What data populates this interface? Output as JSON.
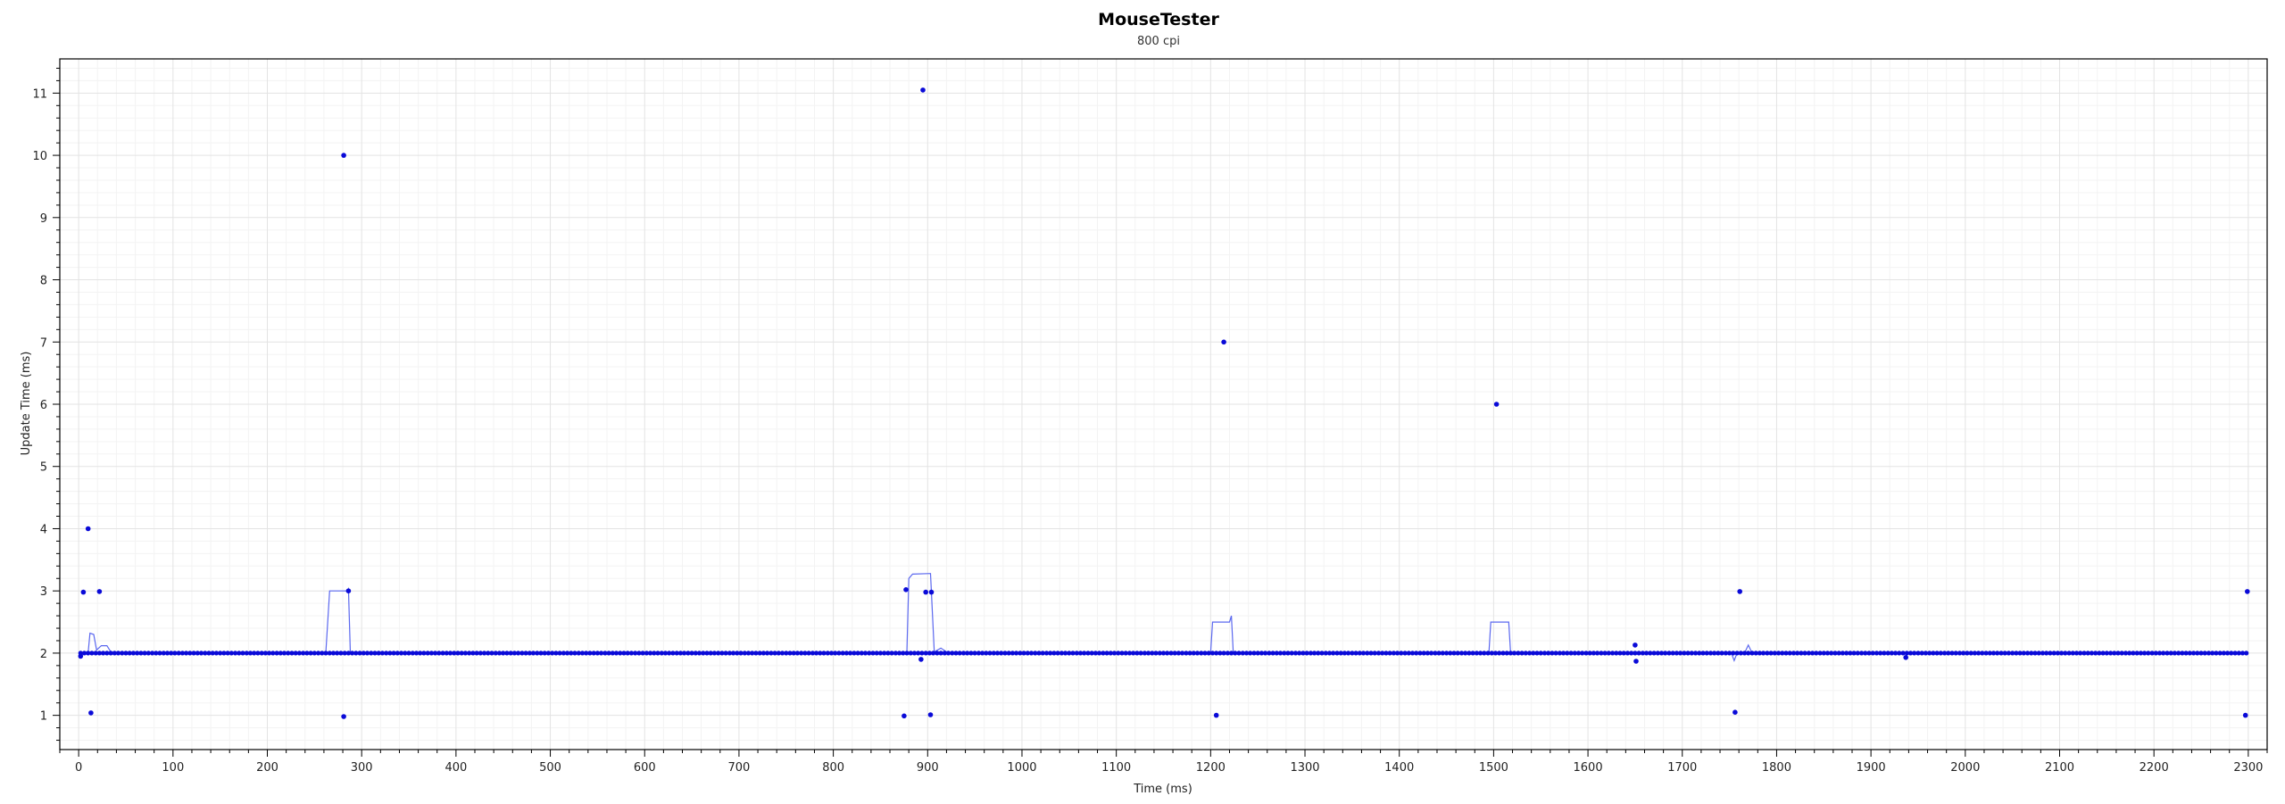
{
  "chart_data": {
    "type": "scatter",
    "title": "MouseTester",
    "subtitle": "800 cpi",
    "xlabel": "Time (ms)",
    "ylabel": "Update Time (ms)",
    "xlim": [
      -20,
      2320
    ],
    "ylim": [
      0.45,
      11.55
    ],
    "x_ticks": [
      0,
      100,
      200,
      300,
      400,
      500,
      600,
      700,
      800,
      900,
      1000,
      1100,
      1200,
      1300,
      1400,
      1500,
      1600,
      1700,
      1800,
      1900,
      2000,
      2100,
      2200,
      2300
    ],
    "y_ticks": [
      1,
      2,
      3,
      4,
      5,
      6,
      7,
      8,
      9,
      10,
      11
    ],
    "grid": true,
    "marker_color": "#0a0ad8",
    "line_color": "#5b68ef",
    "series": [
      {
        "kind": "points",
        "baseline": {
          "x_start": 2,
          "x_end": 2300,
          "step": 4,
          "y": 2
        },
        "outliers": [
          {
            "x": 2,
            "y": 1.95
          },
          {
            "x": 5,
            "y": 2.98
          },
          {
            "x": 10,
            "y": 4.0
          },
          {
            "x": 13,
            "y": 1.04
          },
          {
            "x": 22,
            "y": 2.99
          },
          {
            "x": 281,
            "y": 10.0
          },
          {
            "x": 281,
            "y": 0.98
          },
          {
            "x": 286,
            "y": 3.0
          },
          {
            "x": 875,
            "y": 0.99
          },
          {
            "x": 877,
            "y": 3.02
          },
          {
            "x": 893,
            "y": 1.9
          },
          {
            "x": 895,
            "y": 11.05
          },
          {
            "x": 898,
            "y": 2.98
          },
          {
            "x": 903,
            "y": 1.01
          },
          {
            "x": 904,
            "y": 2.98
          },
          {
            "x": 1206,
            "y": 1.0
          },
          {
            "x": 1214,
            "y": 7.0
          },
          {
            "x": 1503,
            "y": 6.0
          },
          {
            "x": 1650,
            "y": 2.13
          },
          {
            "x": 1651,
            "y": 1.87
          },
          {
            "x": 1756,
            "y": 1.05
          },
          {
            "x": 1761,
            "y": 2.99
          },
          {
            "x": 1937,
            "y": 1.93
          },
          {
            "x": 2297,
            "y": 1.0
          },
          {
            "x": 2299,
            "y": 2.99
          }
        ]
      },
      {
        "kind": "line",
        "points": [
          [
            2,
            2.0
          ],
          [
            10,
            2.0
          ],
          [
            12,
            2.32
          ],
          [
            16,
            2.3
          ],
          [
            19,
            2.05
          ],
          [
            24,
            2.12
          ],
          [
            30,
            2.12
          ],
          [
            34,
            2.02
          ],
          [
            40,
            2.0
          ],
          [
            262,
            2.0
          ],
          [
            266,
            3.0
          ],
          [
            285,
            3.0
          ],
          [
            286,
            3.03
          ],
          [
            288,
            2.0
          ],
          [
            878,
            2.0
          ],
          [
            880,
            3.2
          ],
          [
            884,
            3.27
          ],
          [
            903,
            3.28
          ],
          [
            907,
            2.02
          ],
          [
            914,
            2.08
          ],
          [
            922,
            2.0
          ],
          [
            1200,
            2.0
          ],
          [
            1202,
            2.5
          ],
          [
            1220,
            2.5
          ],
          [
            1222,
            2.6
          ],
          [
            1224,
            2.0
          ],
          [
            1495,
            2.0
          ],
          [
            1497,
            2.5
          ],
          [
            1516,
            2.5
          ],
          [
            1518,
            2.0
          ],
          [
            1752,
            2.0
          ],
          [
            1755,
            1.88
          ],
          [
            1758,
            2.0
          ],
          [
            1766,
            2.0
          ],
          [
            1770,
            2.13
          ],
          [
            1774,
            2.0
          ],
          [
            2298,
            2.0
          ]
        ]
      }
    ]
  }
}
